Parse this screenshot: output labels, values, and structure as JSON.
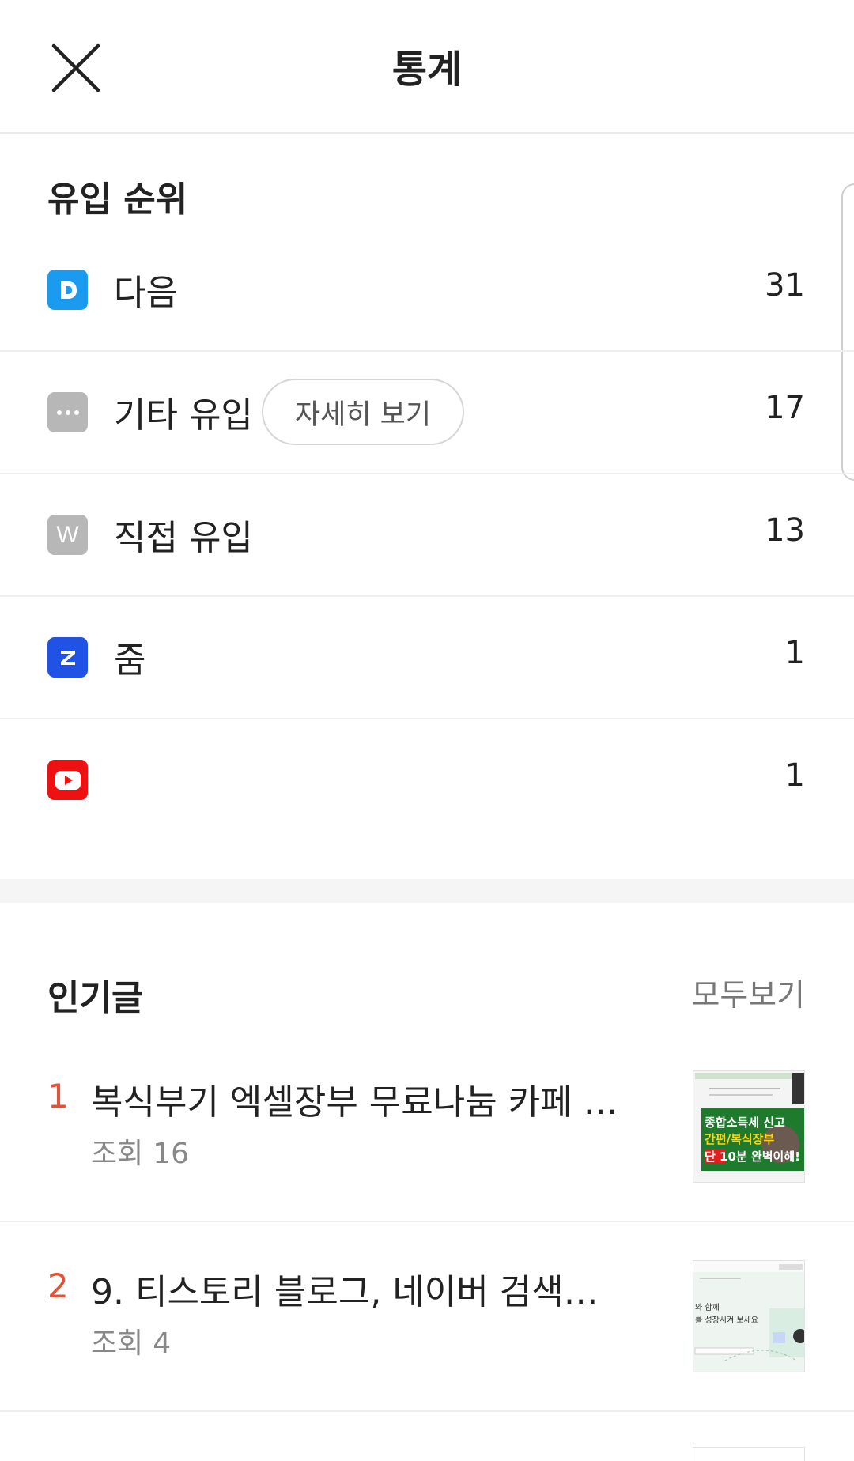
{
  "header": {
    "title": "통계"
  },
  "inflow": {
    "title": "유입 순위",
    "detail_button": "자세히 보기",
    "rows": [
      {
        "icon": "D",
        "label": "다음",
        "count": "31",
        "color": "#1a9bf0"
      },
      {
        "icon": "···",
        "label": "기타 유입",
        "count": "17",
        "color": "#b7b7b7"
      },
      {
        "icon": "W",
        "label": "직접 유입",
        "count": "13",
        "color": "#b7b7b7"
      },
      {
        "icon": "Z",
        "label": "줌",
        "count": "1",
        "color": "#2052e6"
      },
      {
        "icon": "youtube-icon",
        "label": "",
        "count": "1",
        "color": "#ee1111"
      }
    ]
  },
  "popular": {
    "title": "인기글",
    "view_all": "모두보기",
    "views_label": "조회",
    "posts": [
      {
        "rank": "1",
        "title": "복식부기 엑셀장부 무료나눔 카페 소…",
        "views": "16"
      },
      {
        "rank": "2",
        "title": "9. 티스토리 블로그, 네이버 검색…",
        "views": "4"
      }
    ]
  },
  "thumb1": {
    "line1": "종합소득세 신고",
    "line2": "간편/복식장부",
    "line3": "단 10분 완벽이해!"
  },
  "thumb2": {
    "line1": "와 함께",
    "line2": "를 성장시켜 보세요"
  }
}
